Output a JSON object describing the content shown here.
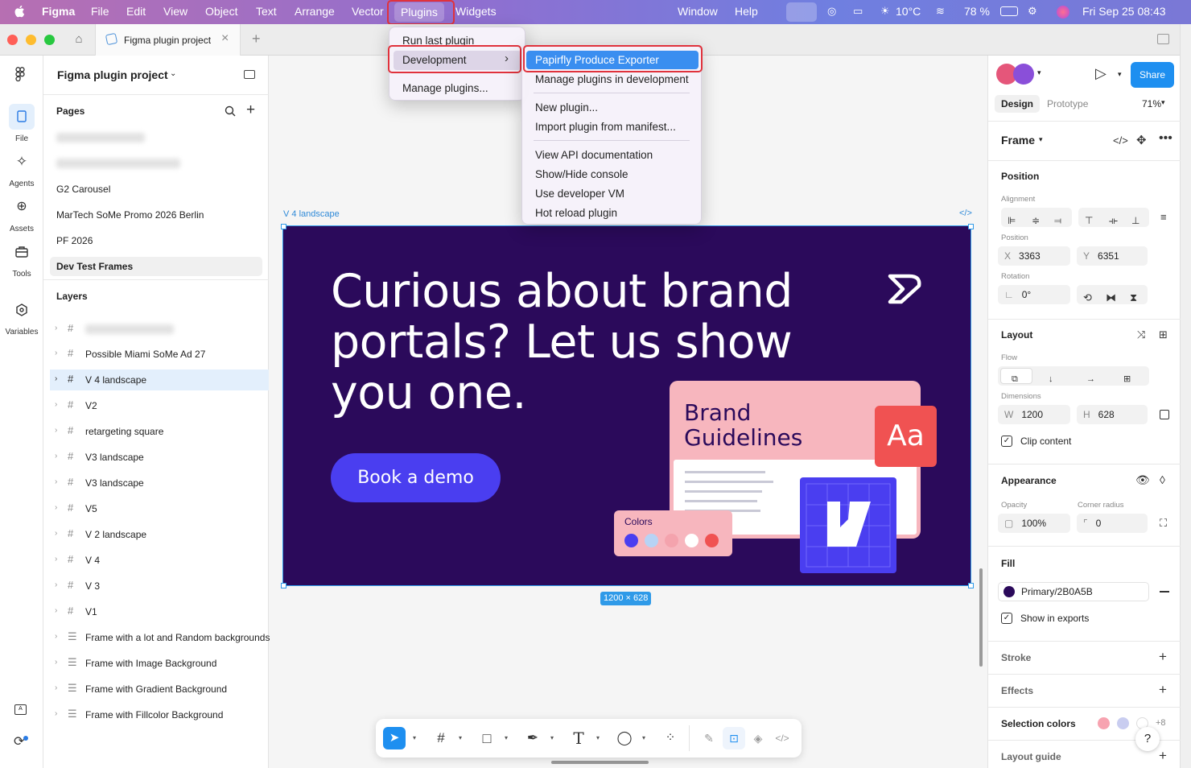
{
  "menubar": {
    "app_name": "Figma",
    "items": [
      "File",
      "Edit",
      "View",
      "Object",
      "Text",
      "Arrange",
      "Vector",
      "Plugins",
      "Widgets"
    ],
    "right_items": [
      "Window",
      "Help"
    ],
    "status": {
      "battery": "78 %",
      "weather": "10°C",
      "datetime": "Fri Sep 25  08:43"
    }
  },
  "tabbar": {
    "tab_title": "Figma plugin project"
  },
  "rail": {
    "items": [
      {
        "label": "File",
        "icon": "file-icon"
      },
      {
        "label": "Agents",
        "icon": "sparkle-icon"
      },
      {
        "label": "Assets",
        "icon": "plus-circle-icon"
      },
      {
        "label": "Tools",
        "icon": "toolbox-icon"
      },
      {
        "label": "Variables",
        "icon": "hexagon-icon"
      }
    ]
  },
  "left_panel": {
    "project_name": "Figma plugin project",
    "pages_title": "Pages",
    "pages": [
      "G2 Carousel",
      "MarTech SoMe Promo 2026 Berlin",
      "PF 2026",
      "Dev Test Frames"
    ],
    "layers_title": "Layers",
    "layers": [
      "Possible Miami SoMe Ad 27",
      "V 4 landscape",
      "V2",
      "retargeting square",
      "V3 landscape",
      "V3 landscape",
      "V5",
      "V 2 landscape",
      "V 4",
      "V 3",
      "V1",
      "Frame with a lot and Random backgrounds",
      "Frame with Image Background",
      "Frame with Gradient Background",
      "Frame with Fillcolor Background"
    ]
  },
  "plugins_menu": {
    "items": [
      "Run last plugin",
      "Development",
      "Manage plugins..."
    ]
  },
  "dev_submenu": {
    "items": [
      "Papirfly Produce Exporter",
      "Manage plugins in development",
      "New plugin...",
      "Import plugin from manifest...",
      "View API documentation",
      "Show/Hide console",
      "Use developer VM",
      "Hot reload plugin"
    ]
  },
  "canvas": {
    "frame_label": "V 4 landscape",
    "size_badge": "1200 × 628",
    "headline": "Curious about brand portals? Let us show you one.",
    "cta": "Book a demo",
    "card_title": "Brand Guidelines",
    "aa": "Aa",
    "colors_label": "Colors",
    "swatches": [
      "#4a3ef0",
      "#b7d3f5",
      "#f4a3ad",
      "#ffffff",
      "#f05252"
    ],
    "bg": "#2b0a5b",
    "accent": "#4a3ef0"
  },
  "right_panel": {
    "tabs": [
      "Design",
      "Prototype"
    ],
    "zoom": "71%",
    "share": "Share",
    "frame_title": "Frame",
    "position_title": "Position",
    "alignment_label": "Alignment",
    "position_label": "Position",
    "x_label": "X",
    "x": "3363",
    "y_label": "Y",
    "y": "6351",
    "rotation_label": "Rotation",
    "rotation": "0°",
    "layout_title": "Layout",
    "flow_label": "Flow",
    "dimensions_label": "Dimensions",
    "w_label": "W",
    "w": "1200",
    "h_label": "H",
    "h": "628",
    "clip_content": "Clip content",
    "appearance_title": "Appearance",
    "opacity_label": "Opacity",
    "opacity": "100%",
    "corner_label": "Corner radius",
    "corner": "0",
    "fill_title": "Fill",
    "fill_value": "Primary/2B0A5B",
    "show_in_exports": "Show in exports",
    "stroke_title": "Stroke",
    "effects_title": "Effects",
    "selection_colors_title": "Selection colors",
    "selection_more": "+8",
    "layout_guide_title": "Layout guide"
  }
}
